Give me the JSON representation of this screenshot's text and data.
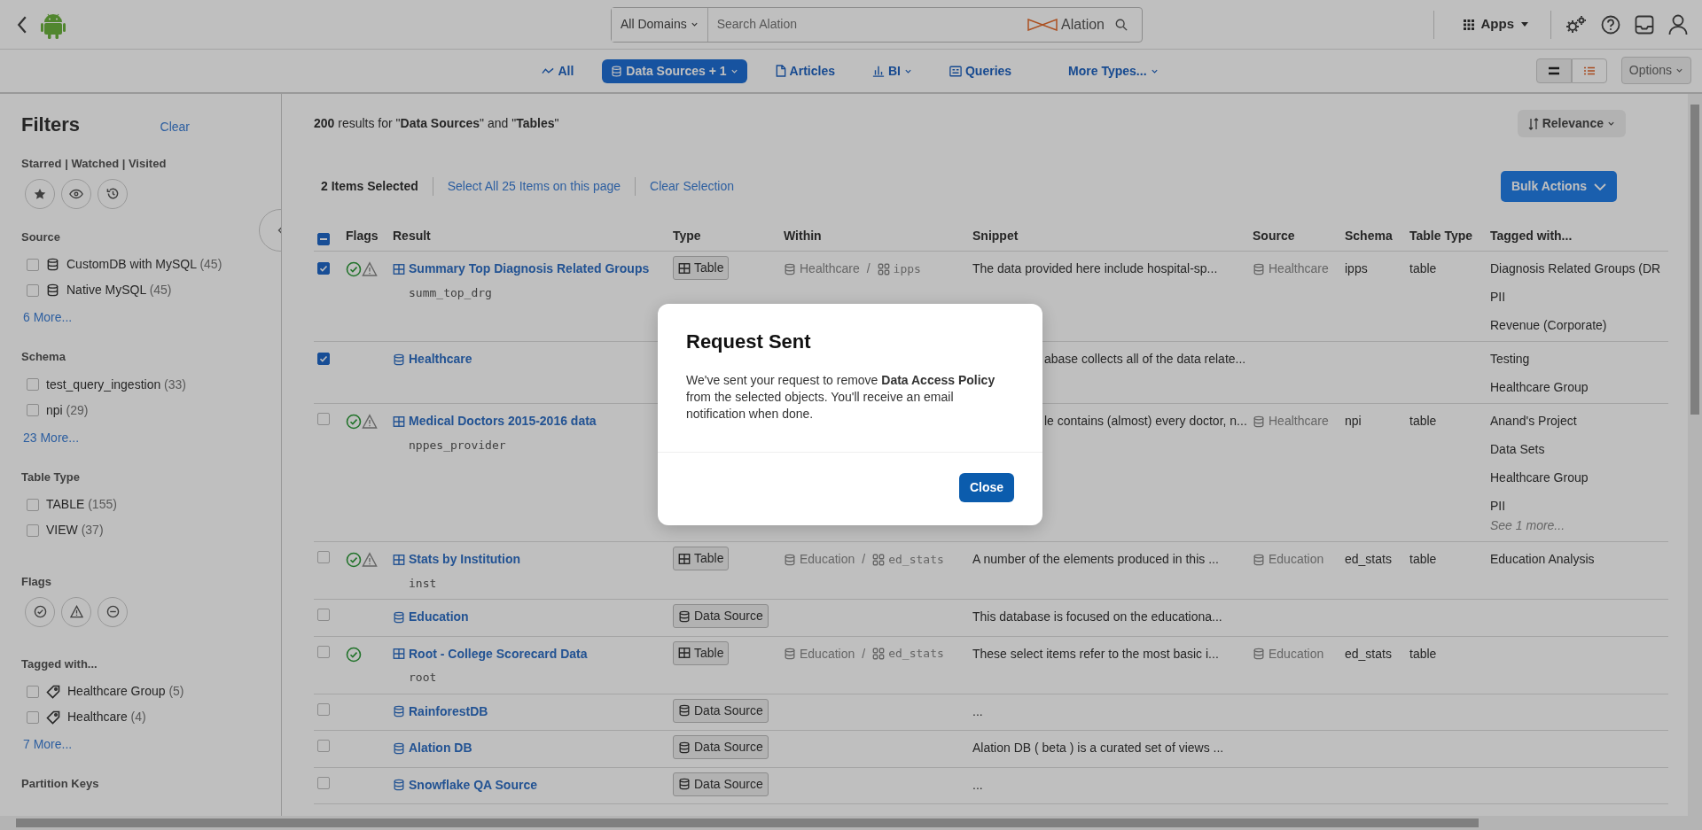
{
  "header": {
    "domain_filter": "All Domains",
    "search": {
      "placeholder": "Search Alation"
    },
    "brand": "Alation",
    "apps_menu": "Apps"
  },
  "type_tabs": [
    {
      "label": "All",
      "kind": "all",
      "selected": false,
      "dropdown": false
    },
    {
      "label": "Data Sources + 1",
      "kind": "data_sources",
      "selected": true,
      "dropdown": true
    },
    {
      "label": "Articles",
      "kind": "articles",
      "selected": false,
      "dropdown": false
    },
    {
      "label": "BI",
      "kind": "bi",
      "selected": false,
      "dropdown": true
    },
    {
      "label": "Queries",
      "kind": "queries",
      "selected": false,
      "dropdown": false
    },
    {
      "label": "More Types...",
      "kind": "more",
      "selected": false,
      "dropdown": true
    }
  ],
  "view_modes": [
    {
      "kind": "compact",
      "selected": false
    },
    {
      "kind": "detailed",
      "selected": true
    }
  ],
  "options_menu": "Options",
  "filters": {
    "title": "Filters",
    "clear": "Clear",
    "sections": [
      {
        "title": "Starred | Watched | Visited",
        "kind": "icon_buttons",
        "buttons": [
          {
            "kind": "starred"
          },
          {
            "kind": "watched"
          },
          {
            "kind": "visited"
          }
        ]
      },
      {
        "title": "Source",
        "kind": "checklist",
        "items": [
          {
            "label": "CustomDB with MySQL",
            "count": "(45)",
            "checked": false,
            "kind": "data_source"
          },
          {
            "label": "Native MySQL",
            "count": "(45)",
            "checked": false,
            "kind": "data_source"
          }
        ],
        "more": "6 More..."
      },
      {
        "title": "Schema",
        "kind": "checklist",
        "items": [
          {
            "label": "test_query_ingestion",
            "count": "(33)",
            "checked": false,
            "kind": "plain"
          },
          {
            "label": "npi",
            "count": "(29)",
            "checked": false,
            "kind": "plain"
          }
        ],
        "more": "23 More..."
      },
      {
        "title": "Table Type",
        "kind": "checklist",
        "items": [
          {
            "label": "TABLE",
            "count": "(155)",
            "checked": false,
            "kind": "plain"
          },
          {
            "label": "VIEW",
            "count": "(37)",
            "checked": false,
            "kind": "plain"
          }
        ]
      },
      {
        "title": "Flags",
        "kind": "icon_buttons",
        "buttons": [
          {
            "kind": "endorsed"
          },
          {
            "kind": "warning"
          },
          {
            "kind": "deprecated"
          }
        ]
      },
      {
        "title": "Tagged with...",
        "kind": "checklist",
        "items": [
          {
            "label": "Healthcare Group",
            "count": "(5)",
            "checked": false,
            "kind": "tag"
          },
          {
            "label": "Healthcare",
            "count": "(4)",
            "checked": false,
            "kind": "tag"
          }
        ],
        "more": "7 More..."
      },
      {
        "title": "Partition Keys",
        "kind": "heading"
      }
    ]
  },
  "results": {
    "summary": "**200** results for \"**Data Sources**\" and \"**Tables**\"",
    "sort": "Relevance",
    "selected_count": "2 Items Selected",
    "select_all": "Select All 25 Items on this page",
    "clear_selection": "Clear Selection",
    "bulk_actions": "Bulk Actions",
    "header_checkbox": {
      "indeterminate": true
    },
    "columns": [
      "Flags",
      "Result",
      "Type",
      "Within",
      "Snippet",
      "Source",
      "Schema",
      "Table Type",
      "Tagged with..."
    ],
    "rows": [
      {
        "checked": true,
        "flags": [
          {
            "kind": "endorsed"
          },
          {
            "kind": "warning"
          }
        ],
        "kind": "table",
        "title": "Summary Top Diagnosis Related Groups",
        "subtitle": "summ_top_drg",
        "type": "Table",
        "within": {
          "source": "Healthcare",
          "separator": "/",
          "schema": "ipps"
        },
        "snippet": "The data provided here include hospital-sp...",
        "source": "Healthcare",
        "schema": "ipps",
        "table_type": "table",
        "tags": [
          "Diagnosis Related Groups (DR",
          "PII",
          "Revenue (Corporate)"
        ]
      },
      {
        "checked": true,
        "flags": [],
        "kind": "data_source",
        "title": "Healthcare",
        "snippet": "abase collects all of the data relate...",
        "tags": [
          "Testing",
          "Healthcare Group"
        ]
      },
      {
        "checked": false,
        "flags": [
          {
            "kind": "endorsed"
          },
          {
            "kind": "warning"
          }
        ],
        "kind": "table",
        "title": "Medical Doctors 2015-2016 data",
        "subtitle": "nppes_provider",
        "snippet": "le contains (almost) every doctor, n...",
        "source": "Healthcare",
        "schema": "npi",
        "table_type": "table",
        "tags": [
          "Anand's Project",
          "Data Sets",
          "Healthcare Group",
          "PII"
        ],
        "more_tags": "See 1 more..."
      },
      {
        "checked": false,
        "flags": [
          {
            "kind": "endorsed"
          },
          {
            "kind": "warning"
          }
        ],
        "kind": "table",
        "title": "Stats by Institution",
        "subtitle": "inst",
        "type": "Table",
        "within": {
          "source": "Education",
          "separator": "/",
          "schema": "ed_stats"
        },
        "snippet": "A number of the elements produced in this ...",
        "source": "Education",
        "schema": "ed_stats",
        "table_type": "table",
        "tags": [
          "Education Analysis"
        ]
      },
      {
        "checked": false,
        "flags": [],
        "kind": "data_source",
        "title": "Education",
        "type": "Data Source",
        "snippet": "This database is focused on the educationa..."
      },
      {
        "checked": false,
        "flags": [
          {
            "kind": "endorsed"
          }
        ],
        "kind": "table",
        "title": "Root - College Scorecard Data",
        "subtitle": "root",
        "type": "Table",
        "within": {
          "source": "Education",
          "separator": "/",
          "schema": "ed_stats"
        },
        "snippet": "These select items refer to the most basic i...",
        "source": "Education",
        "schema": "ed_stats",
        "table_type": "table"
      },
      {
        "checked": false,
        "flags": [],
        "kind": "data_source",
        "title": "RainforestDB",
        "type": "Data Source",
        "snippet": "..."
      },
      {
        "checked": false,
        "flags": [],
        "kind": "data_source",
        "title": "Alation DB",
        "type": "Data Source",
        "snippet": "Alation DB ( beta ) is a curated set of views ..."
      },
      {
        "checked": false,
        "flags": [],
        "kind": "data_source",
        "title": "Snowflake QA Source",
        "type": "Data Source",
        "snippet": "..."
      }
    ]
  },
  "modal": {
    "title": "Request Sent",
    "body": "We've sent your request to remove **Data Access Policy** from the selected objects. You'll receive an email notification when done.",
    "button": "Close"
  }
}
